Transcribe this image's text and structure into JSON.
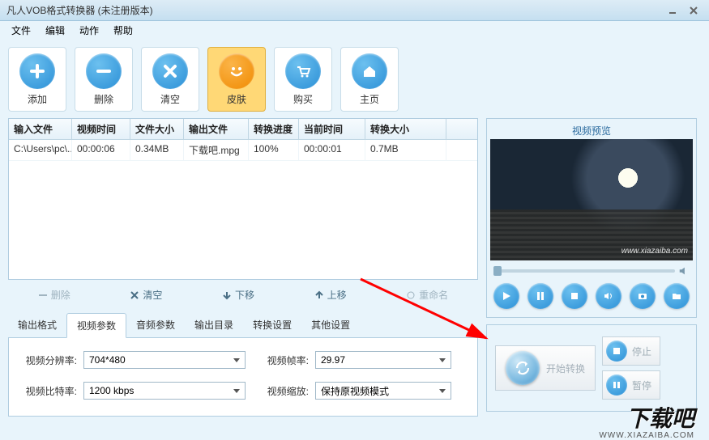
{
  "window": {
    "title": "凡人VOB格式转换器  (未注册版本)"
  },
  "menu": {
    "file": "文件",
    "edit": "编辑",
    "action": "动作",
    "help": "帮助"
  },
  "toolbar": {
    "add": "添加",
    "delete": "删除",
    "clear": "清空",
    "skin": "皮肤",
    "buy": "购买",
    "home": "主页"
  },
  "table": {
    "headers": {
      "input": "输入文件",
      "vtime": "视频时间",
      "fsize": "文件大小",
      "output": "输出文件",
      "progress": "转换进度",
      "curtime": "当前时间",
      "outsize": "转换大小"
    },
    "rows": [
      {
        "input": "C:\\Users\\pc\\..",
        "vtime": "00:00:06",
        "fsize": "0.34MB",
        "output": "下载吧.mpg",
        "progress": "100%",
        "curtime": "00:00:01",
        "outsize": "0.7MB"
      }
    ]
  },
  "listops": {
    "delete": "删除",
    "clear": "清空",
    "down": "下移",
    "up": "上移",
    "rename": "重命名"
  },
  "tabs": {
    "outfmt": "输出格式",
    "vparam": "视频参数",
    "aparam": "音频参数",
    "outdir": "输出目录",
    "convset": "转换设置",
    "other": "其他设置"
  },
  "form": {
    "resolution_label": "视频分辨率:",
    "resolution_value": "704*480",
    "framerate_label": "视频帧率:",
    "framerate_value": "29.97",
    "bitrate_label": "视频比特率:",
    "bitrate_value": "1200 kbps",
    "zoom_label": "视频缩放:",
    "zoom_value": "保持原视频模式"
  },
  "preview": {
    "title": "视频预览",
    "watermark": "www.xiazaiba.com"
  },
  "actions": {
    "start": "开始转换",
    "stop": "停止",
    "pause": "暂停"
  },
  "brand": {
    "name": "下载吧",
    "url": "WWW.XIAZAIBA.COM"
  }
}
